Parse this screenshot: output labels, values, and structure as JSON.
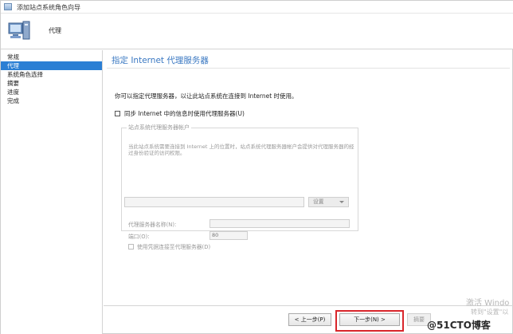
{
  "window": {
    "title": "添加站点系统角色向导"
  },
  "header": {
    "title": "代理"
  },
  "nav": {
    "items": [
      {
        "label": "常规",
        "active": false
      },
      {
        "label": "代理",
        "active": true
      },
      {
        "label": "系统角色选择",
        "active": false
      },
      {
        "label": "摘要",
        "active": false
      },
      {
        "label": "进度",
        "active": false
      },
      {
        "label": "完成",
        "active": false
      }
    ]
  },
  "content": {
    "page_title": "指定 Internet 代理服务器",
    "intro": "你可以指定代理服务器，以让此站点系统在连接到 Internet 时使用。",
    "sync_label": "同步 Internet 中的信息时使用代理服务器(U)",
    "group": {
      "legend": "站点系统代理服务器帐户",
      "description": "当此站点系统需要连接到 Internet 上的位置时，站点系统代理服务器帐户会提供对代理服务器的经过身份验证的访问权限。",
      "proxy_name_label": "代理服务器名称(N):",
      "proxy_name_value": "",
      "port_label": "端口(O):",
      "port_value": "80",
      "credentials_label": "使用凭据连接至代理服务器(D)",
      "credentials_value": "",
      "settings_label": "设置"
    }
  },
  "footer": {
    "prev_label": "< 上一步(P)",
    "next_label": "下一步(N) >",
    "summary_label": "摘要"
  },
  "overlay": {
    "activation_text": "激活 Windo",
    "activation_sub": "转到\"设置\"以",
    "brand_text": "@51CTO博客"
  },
  "colors": {
    "accent": "#2b7fd4",
    "title": "#3a78c2",
    "highlight": "#d9262b"
  }
}
